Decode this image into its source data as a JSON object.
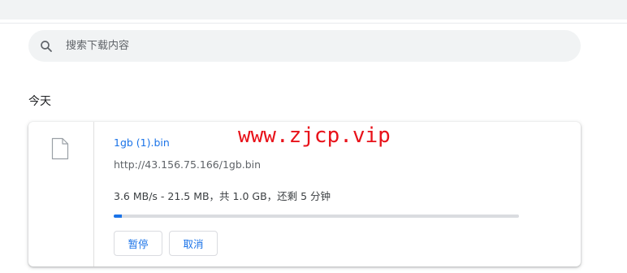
{
  "search": {
    "placeholder": "搜索下载内容",
    "value": ""
  },
  "downloads": {
    "date_heading": "今天",
    "item": {
      "file_name": "1gb (1).bin",
      "url": "http://43.156.75.166/1gb.bin",
      "status": "3.6 MB/s - 21.5 MB，共 1.0 GB，还剩 5 分钟",
      "progress_fraction": 0.02,
      "pause_label": "暂停",
      "cancel_label": "取消"
    },
    "watermark": "www.zjcp.vip"
  },
  "colors": {
    "accent": "#1a73e8",
    "watermark": "#e8121a",
    "search_bg": "#f1f3f4"
  },
  "icons": {
    "search": "search-icon",
    "file": "file-icon"
  }
}
